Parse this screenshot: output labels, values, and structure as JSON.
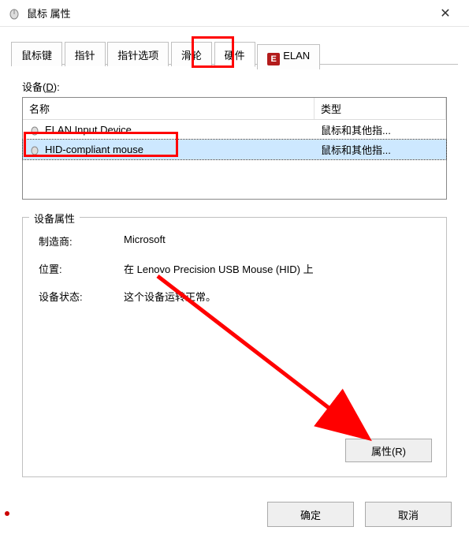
{
  "titlebar": {
    "title": "鼠标 属性",
    "close": "✕"
  },
  "tabs": [
    {
      "label": "鼠标键"
    },
    {
      "label": "指针"
    },
    {
      "label": "指针选项"
    },
    {
      "label": "滑轮"
    },
    {
      "label": "硬件"
    },
    {
      "label": "ELAN"
    }
  ],
  "devices_label_prefix": "设备(",
  "devices_label_key": "D",
  "devices_label_suffix": "):",
  "columns": {
    "name": "名称",
    "type": "类型"
  },
  "device_rows": [
    {
      "name": "ELAN Input Device",
      "type": "鼠标和其他指..."
    },
    {
      "name": "HID-compliant mouse",
      "type": "鼠标和其他指..."
    }
  ],
  "group": {
    "title": "设备属性",
    "manufacturer_label": "制造商:",
    "manufacturer_value": "Microsoft",
    "location_label": "位置:",
    "location_value": "在 Lenovo Precision USB Mouse (HID) 上",
    "status_label": "设备状态:",
    "status_value": "这个设备运转正常。",
    "properties_button": "属性(R)"
  },
  "buttons": {
    "ok": "确定",
    "cancel": "取消"
  },
  "annotations": {
    "hardware_tab_highlight": true,
    "selected_device_highlight": true,
    "arrow_to_properties": true
  }
}
